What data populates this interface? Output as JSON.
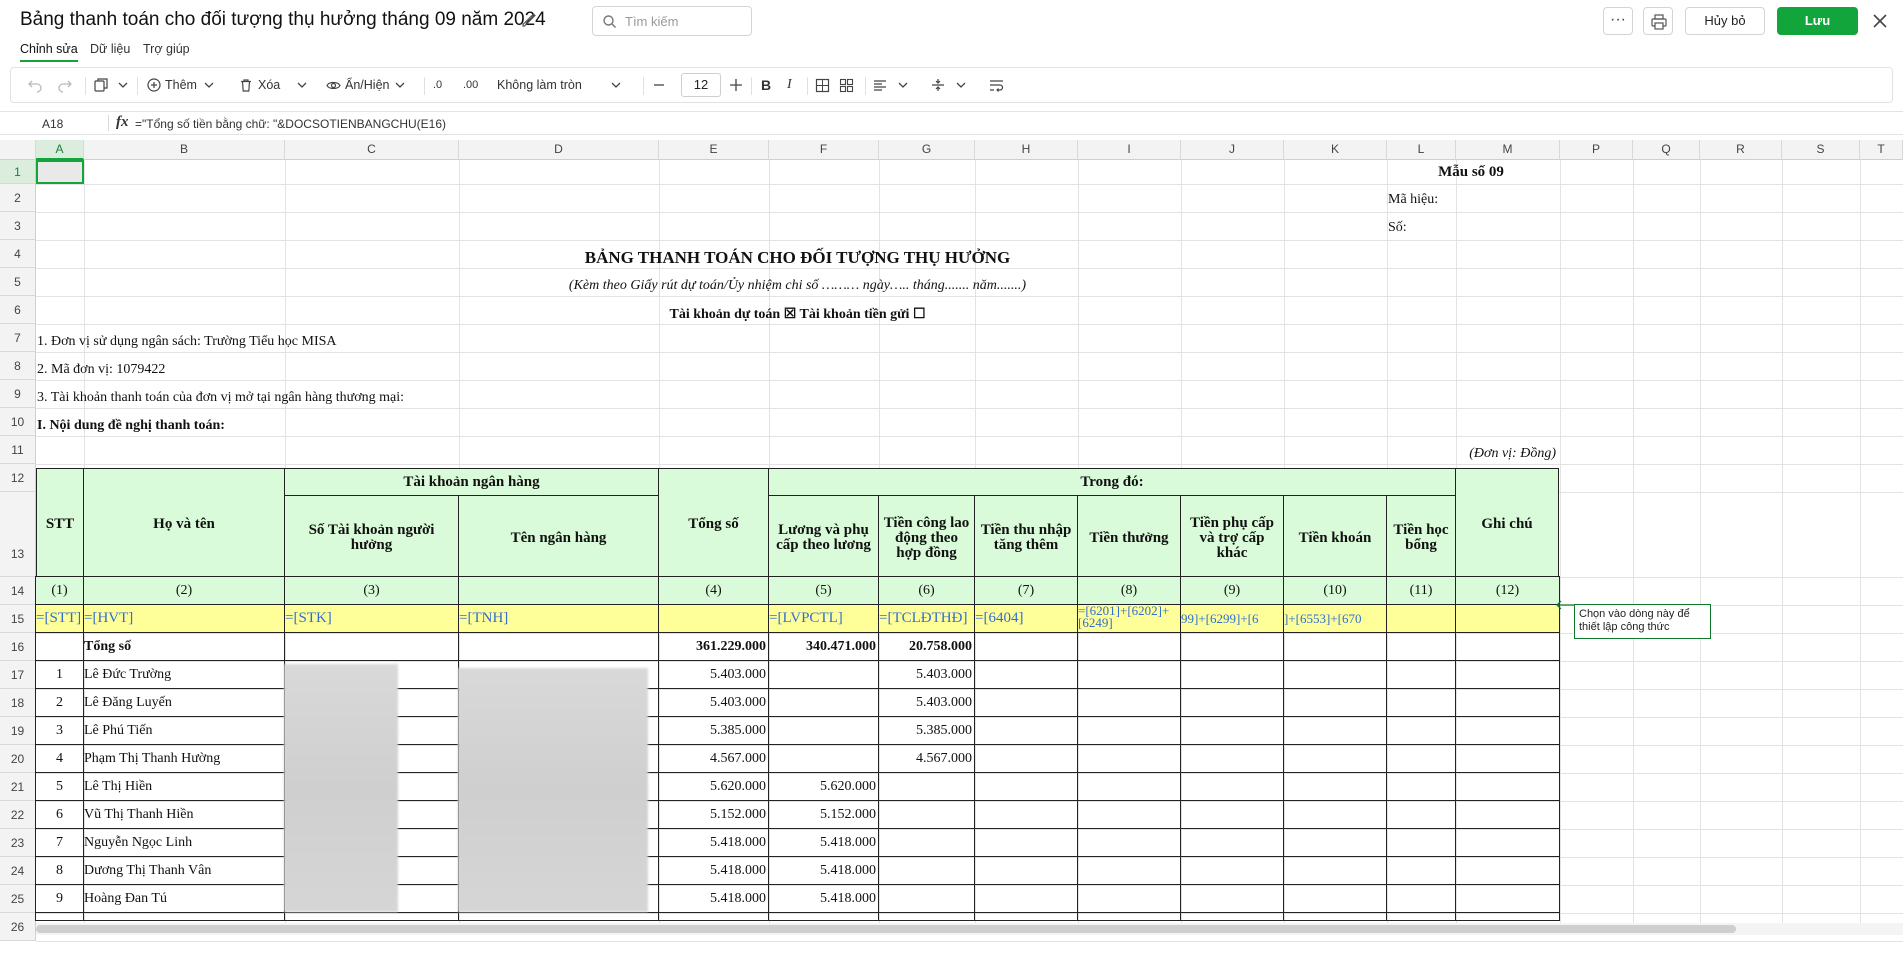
{
  "title": "Bảng thanh toán cho đối tượng thụ hưởng tháng 09 năm 2024",
  "search": {
    "placeholder": "Tìm kiếm"
  },
  "header_buttons": {
    "more": "···",
    "cancel": "Hủy bỏ",
    "save": "Lưu"
  },
  "menu": {
    "tabs": [
      "Chỉnh sửa",
      "Dữ liệu",
      "Trợ giúp"
    ],
    "active": 0
  },
  "toolbar": {
    "add": "Thêm",
    "delete": "Xóa",
    "show_hide": "Ẩn/Hiện",
    "decimal_dec": ".0",
    "decimal_inc": ".00",
    "rounding": "Không làm tròn",
    "font_size": "12",
    "bold": "B",
    "italic": "I"
  },
  "formula_bar": {
    "cell_ref": "A18",
    "fx": "fx",
    "formula": "=\"Tổng số tiền bằng chữ: \"&DOCSOTIENBANGCHU(E16)"
  },
  "columns": [
    "A",
    "B",
    "C",
    "D",
    "E",
    "F",
    "G",
    "H",
    "I",
    "J",
    "K",
    "L",
    "M",
    "P",
    "Q",
    "R",
    "S",
    "T"
  ],
  "rows": [
    "1",
    "2",
    "3",
    "4",
    "5",
    "6",
    "7",
    "8",
    "9",
    "10",
    "11",
    "12",
    "13",
    "14",
    "15",
    "16",
    "17",
    "18",
    "19",
    "20",
    "21",
    "22",
    "23",
    "24",
    "25",
    "26"
  ],
  "sheet": {
    "form_no": "Mẫu số 09",
    "code_label": "Mã hiệu:",
    "no_label": "Số:",
    "heading": "BẢNG THANH TOÁN CHO ĐỐI TƯỢNG THỤ HƯỞNG",
    "subheading": "(Kèm theo Giấy rút dự toán/Ủy nhiệm chi số ……… ngày….. tháng....... năm.......)",
    "accounts_line": "Tài khoản dự toán ☒   Tài khoản tiền gửi ☐",
    "line1": "1. Đơn vị sử dụng ngân sách: Trường Tiểu học MISA",
    "line2": "2. Mã đơn vị: 1079422",
    "line3": "3. Tài khoản thanh toán của đơn vị mở tại ngân hàng thương mại:",
    "section": "I. Nội dung đề nghị thanh toán:",
    "unit": "(Đơn vị: Đồng)",
    "headers": {
      "stt": "STT",
      "name": "Họ và tên",
      "bank_group": "Tài khoản ngân hàng",
      "account_no": "Số Tài khoản người hưởng",
      "bank_name": "Tên ngân hàng",
      "total": "Tổng số",
      "of_which": "Trong đó:",
      "salary": "Lương và phụ cấp theo lương",
      "contract": "Tiền công lao động theo hợp đồng",
      "extra_income": "Tiền thu nhập tăng thêm",
      "bonus": "Tiền thưởng",
      "allowance": "Tiền phụ cấp và trợ cấp khác",
      "lump_sum": "Tiền khoán",
      "scholarship": "Tiền học bổng",
      "note": "Ghi chú"
    },
    "index_row": [
      "(1)",
      "(2)",
      "(3)",
      "",
      "(4)",
      "(5)",
      "(6)",
      "(7)",
      "(8)",
      "(9)",
      "(10)",
      "(11)",
      "(12)"
    ],
    "formula_row": [
      "=[STT]",
      "=[HVT]",
      "=[STK]",
      "=[TNH]",
      "",
      "=[LVPCTL]",
      "=[TCLĐTHĐ]",
      "=[6404]",
      "=[6201]+[6202]+[6249]",
      "99]+[6299]+[6",
      "]+[6553]+[670",
      "",
      ""
    ],
    "total_row": {
      "label": "Tổng số",
      "total": "361.229.000",
      "salary": "340.471.000",
      "contract": "20.758.000"
    },
    "data_rows": [
      {
        "stt": "1",
        "name": "Lê Đức Trường",
        "total": "5.403.000",
        "salary": "",
        "contract": "5.403.000"
      },
      {
        "stt": "2",
        "name": "Lê Đăng Luyến",
        "total": "5.403.000",
        "salary": "",
        "contract": "5.403.000"
      },
      {
        "stt": "3",
        "name": "Lê Phú Tiến",
        "total": "5.385.000",
        "salary": "",
        "contract": "5.385.000"
      },
      {
        "stt": "4",
        "name": "Phạm Thị Thanh  Hường",
        "total": "4.567.000",
        "salary": "",
        "contract": "4.567.000"
      },
      {
        "stt": "5",
        "name": "Lê Thị Hiền",
        "total": "5.620.000",
        "salary": "5.620.000",
        "contract": ""
      },
      {
        "stt": "6",
        "name": "Vũ Thị Thanh Hiền",
        "total": "5.152.000",
        "salary": "5.152.000",
        "contract": ""
      },
      {
        "stt": "7",
        "name": "Nguyễn Ngọc Linh",
        "total": "5.418.000",
        "salary": "5.418.000",
        "contract": ""
      },
      {
        "stt": "8",
        "name": "Dương Thị Thanh Vân",
        "total": "5.418.000",
        "salary": "5.418.000",
        "contract": ""
      },
      {
        "stt": "9",
        "name": "Hoàng Đan Tú",
        "total": "5.418.000",
        "salary": "5.418.000",
        "contract": ""
      }
    ]
  },
  "tooltip": "Chọn vào dòng này để thiết lập công thức",
  "colors": {
    "accent": "#11a53b",
    "header_fill": "#d9fbd9",
    "formula_fill": "#ffff99",
    "formula_text": "#2f6fd1"
  }
}
